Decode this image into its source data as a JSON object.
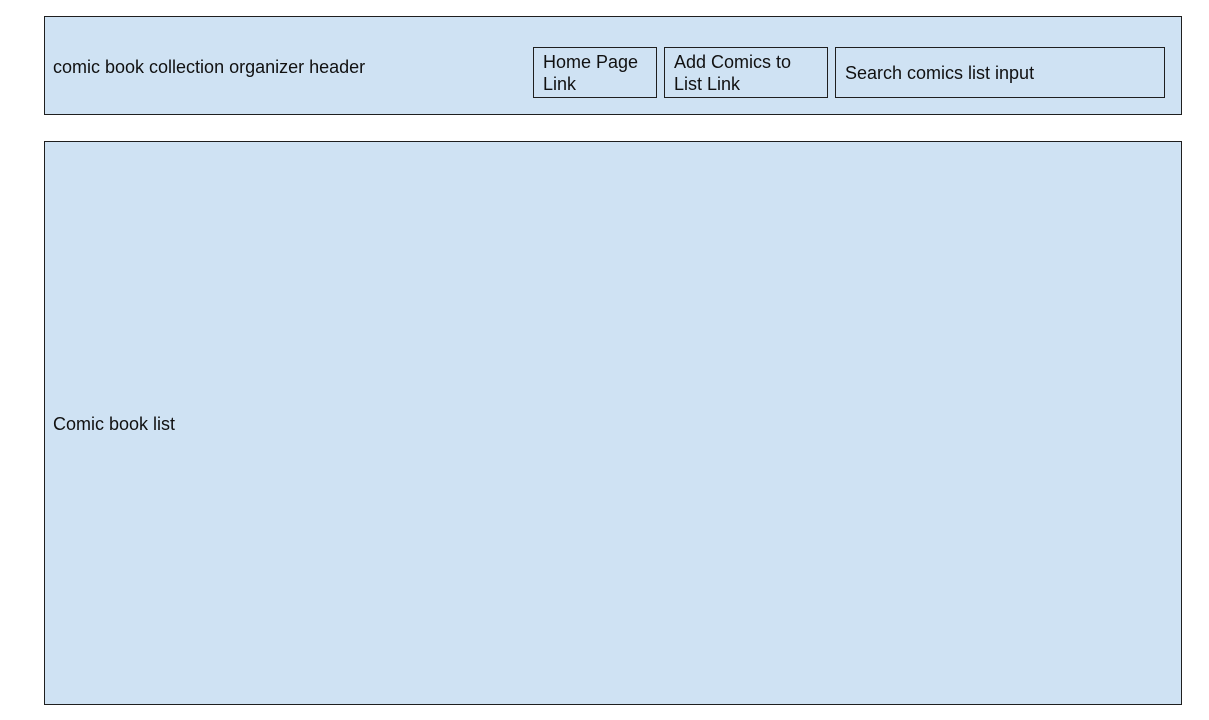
{
  "header": {
    "title": "comic book collection organizer header",
    "home_link": "Home Page Link",
    "add_link": "Add Comics to List Link",
    "search_input": "Search comics list input"
  },
  "main": {
    "list_label": "Comic book list"
  },
  "colors": {
    "box_fill": "#cfe2f3",
    "border": "#1f1f1f",
    "text": "#111111"
  }
}
